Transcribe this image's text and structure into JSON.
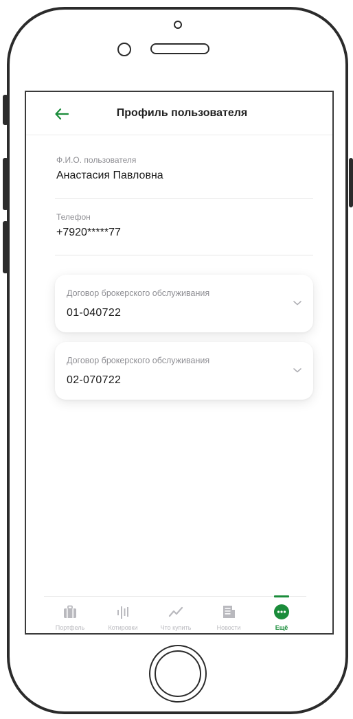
{
  "header": {
    "title": "Профиль пользователя"
  },
  "profile": {
    "name_label": "Ф.И.О. пользователя",
    "name_value": "Анастасия Павловна",
    "phone_label": "Телефон",
    "phone_value": "+7920*****77"
  },
  "contracts": [
    {
      "label": "Договор брокерского обслуживания",
      "value": "01-040722"
    },
    {
      "label": "Договор брокерского обслуживания",
      "value": "02-070722"
    }
  ],
  "nav": {
    "tabs": [
      {
        "label": "Портфель",
        "icon": "briefcase-icon"
      },
      {
        "label": "Котировки",
        "icon": "quotes-icon"
      },
      {
        "label": "Что купить",
        "icon": "trend-icon"
      },
      {
        "label": "Новости",
        "icon": "news-icon"
      },
      {
        "label": "Ещё",
        "icon": "more-icon",
        "active": true
      }
    ]
  },
  "colors": {
    "accent": "#1a8c3a",
    "inactive": "#b9b9be",
    "muted_text": "#8e8e93"
  }
}
